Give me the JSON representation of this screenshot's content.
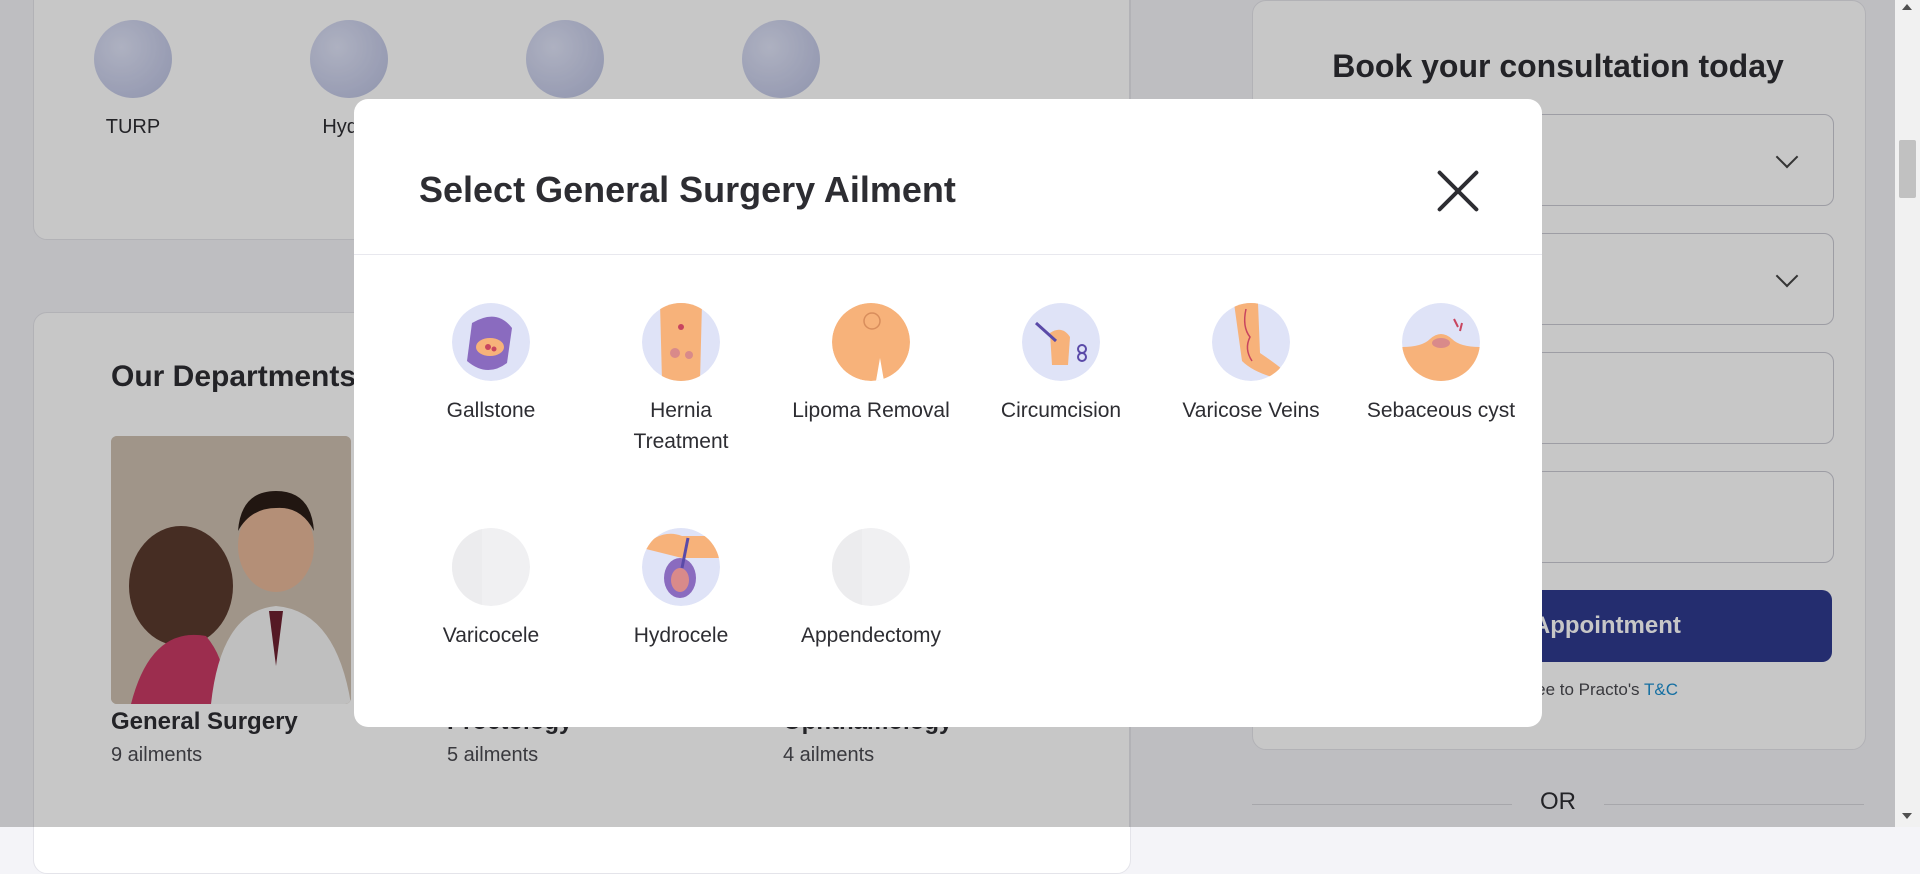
{
  "top_ailments": [
    {
      "label": "TURP",
      "icon": "bladder-icon"
    },
    {
      "label": "Hydro",
      "icon": "hydrocele-icon"
    },
    {
      "label": "",
      "icon": "knee-icon"
    },
    {
      "label": "",
      "icon": "hair-transplant-icon"
    }
  ],
  "departments": {
    "heading": "Our Departments",
    "items": [
      {
        "name": "General Surgery",
        "count": "9 ailments"
      },
      {
        "name": "Proctology",
        "count": "5 ailments"
      },
      {
        "name": "Ophthamology",
        "count": "4 ailments"
      }
    ]
  },
  "booking": {
    "title": "Book your consultation today",
    "button_label": "Book Appointment",
    "button_visible": "ppointment",
    "terms_text": ", you agree to Practo's",
    "terms_link": "T&C",
    "or_label": "OR"
  },
  "modal": {
    "title": "Select General Surgery Ailment",
    "close_icon": "close-icon",
    "ailments": [
      {
        "label": "Gallstone",
        "icon": "gallstone-icon"
      },
      {
        "label": "Hernia Treatment",
        "icon": "hernia-icon"
      },
      {
        "label": "Lipoma Removal",
        "icon": "lipoma-icon"
      },
      {
        "label": "Circumcision",
        "icon": "circumcision-icon"
      },
      {
        "label": "Varicose Veins",
        "icon": "varicose-veins-icon"
      },
      {
        "label": "Sebaceous cyst",
        "icon": "sebaceous-cyst-icon"
      },
      {
        "label": "Varicocele",
        "icon": "varicocele-icon"
      },
      {
        "label": "Hydrocele",
        "icon": "hydrocele-icon"
      },
      {
        "label": "Appendectomy",
        "icon": "appendectomy-icon"
      }
    ]
  },
  "colors": {
    "accent": "#2f3a8f",
    "link": "#1c8fd0",
    "icon_skin": "#f7b27a",
    "icon_purple": "#8a6bbf"
  }
}
